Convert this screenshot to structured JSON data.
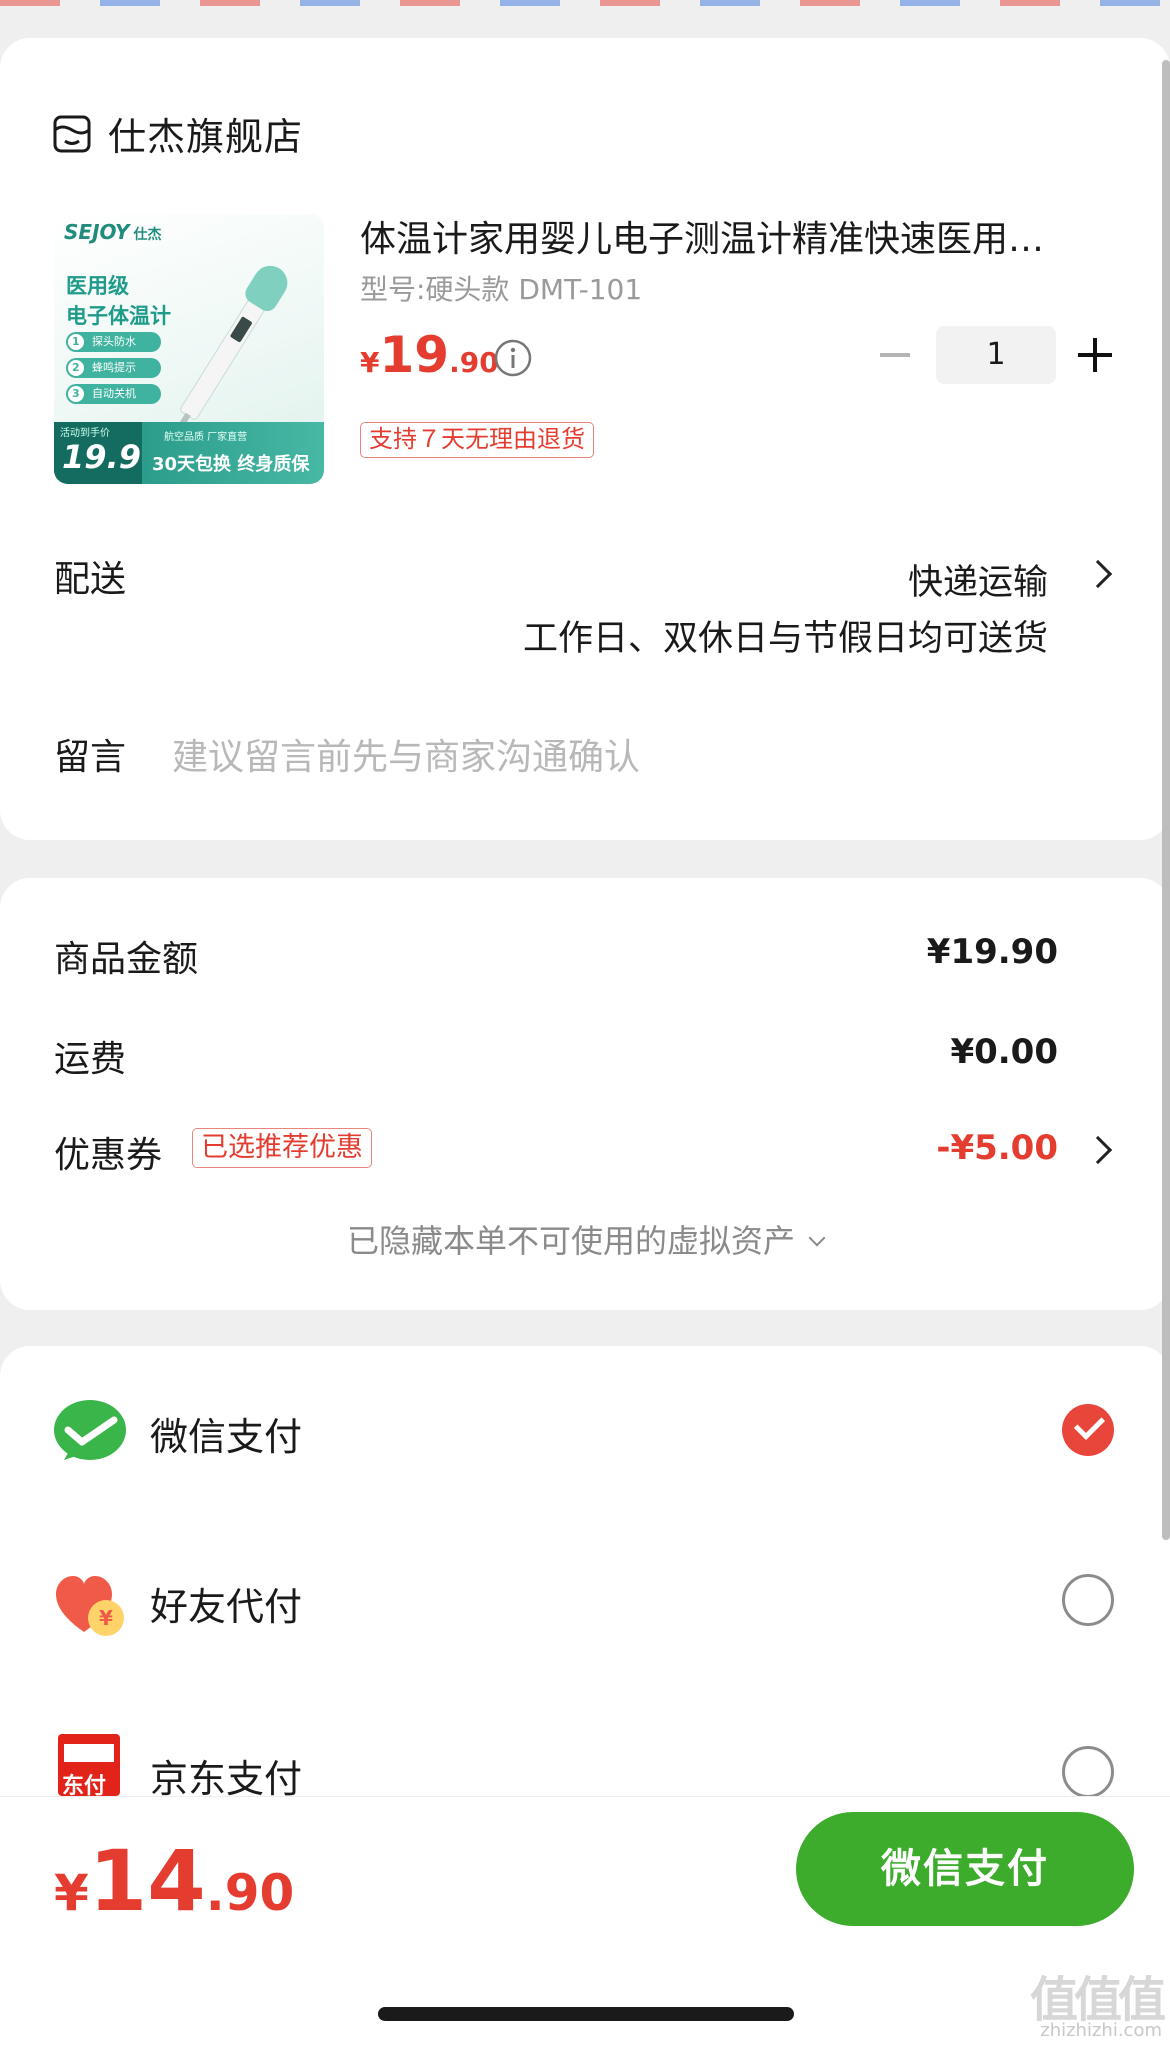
{
  "store": {
    "name": "仕杰旗舰店",
    "icon": "store-icon"
  },
  "product": {
    "title": "体温计家用婴儿电子测温计精准快速医用…",
    "model": "型号:硬头款 DMT-101",
    "price_symbol": "¥",
    "price_int": "19",
    "price_dec": ".90",
    "quantity": "1",
    "return_tag": "支持７天无理由退货",
    "image": {
      "brand": "SEJOY",
      "brand_cn": "仕杰",
      "title_line1": "医用级",
      "title_line2": "电子体温计",
      "features": [
        "探头防水",
        "蜂鸣提示",
        "自动关机"
      ],
      "feature_numbers": [
        "1",
        "2",
        "3"
      ],
      "price_tag": "活动到手价",
      "price": "19.9",
      "sub": "航空品质 厂家直营",
      "slogan": "30天包换 终身质保"
    }
  },
  "delivery": {
    "label": "配送",
    "method": "快递运输",
    "note": "工作日、双休日与节假日均可送货"
  },
  "message": {
    "label": "留言",
    "placeholder": "建议留言前先与商家沟通确认"
  },
  "summary": {
    "goods_label": "商品金额",
    "goods_value": "¥19.90",
    "shipping_label": "运费",
    "shipping_value": "¥0.00",
    "coupon_label": "优惠券",
    "coupon_tag": "已选推荐优惠",
    "coupon_value": "-¥5.00",
    "hidden_assets": "已隐藏本单不可使用的虚拟资产"
  },
  "payment": {
    "methods": [
      {
        "label": "微信支付",
        "icon": "wechat-pay-icon",
        "selected": true
      },
      {
        "label": "好友代付",
        "icon": "friend-pay-icon",
        "selected": false
      },
      {
        "label": "京东支付",
        "icon": "jd-pay-icon",
        "selected": false
      }
    ],
    "jd_icon_text": "东付"
  },
  "footer": {
    "total_symbol": "¥",
    "total_int": "14",
    "total_dec": ".90",
    "pay_button": "微信支付"
  },
  "watermark": {
    "text": "值值值",
    "url": "zhizhizhi.com"
  },
  "colors": {
    "accent_red": "#e43d30",
    "wechat_green": "#3dab2c"
  }
}
